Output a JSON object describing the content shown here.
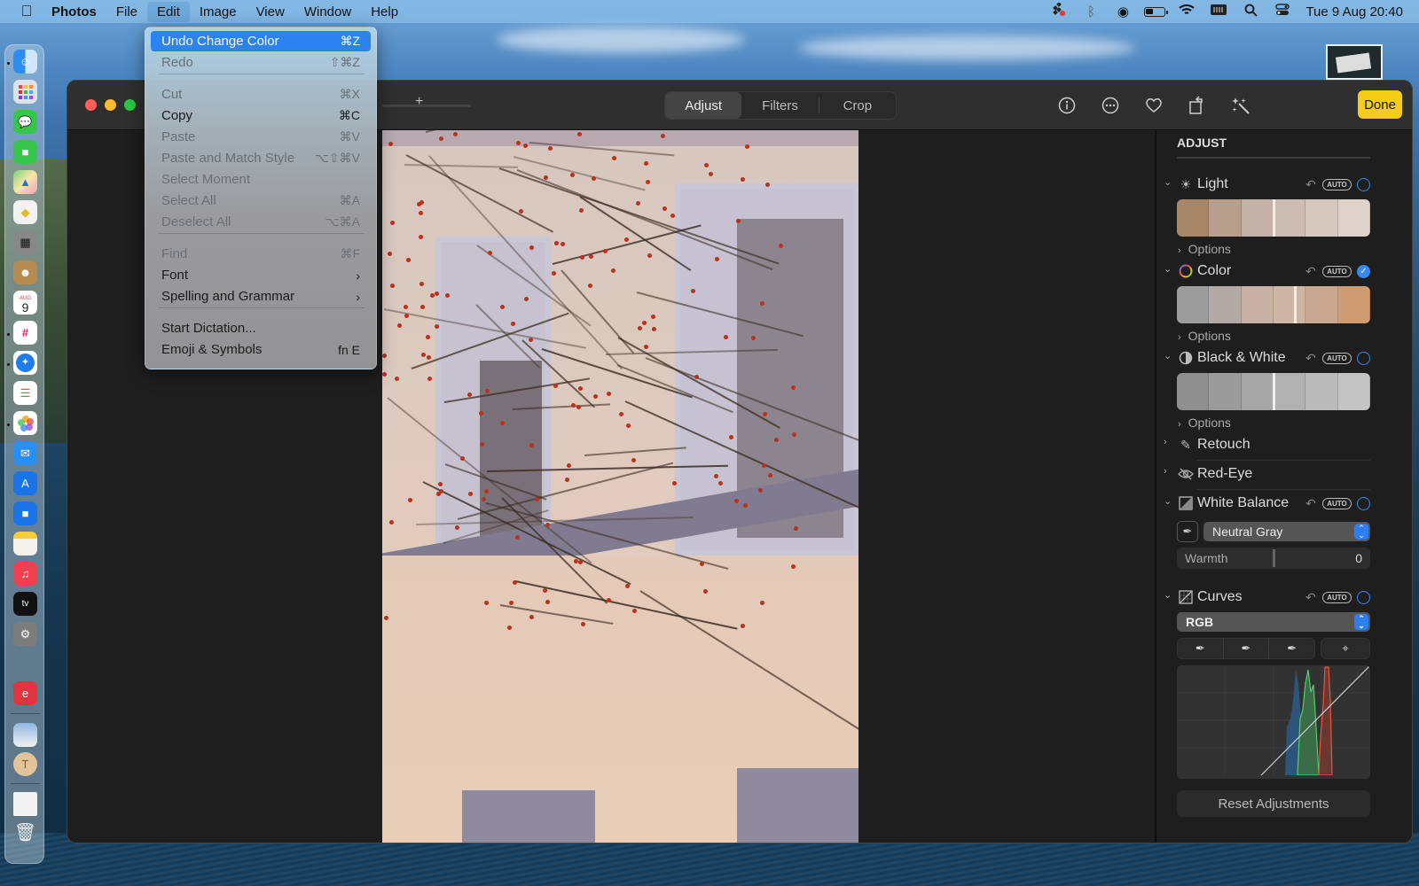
{
  "menubar": {
    "apple": "",
    "app_name": "Photos",
    "items": [
      "File",
      "Edit",
      "Image",
      "View",
      "Window",
      "Help"
    ],
    "active_menu": "Edit",
    "clock": "Tue 9 Aug  20:40"
  },
  "edit_menu": {
    "items": [
      {
        "label": "Undo Change Color",
        "shortcut": "⌘Z",
        "state": "highlighted"
      },
      {
        "label": "Redo",
        "shortcut": "⇧⌘Z",
        "state": "disabled"
      },
      {
        "label": "Cut",
        "shortcut": "⌘X",
        "state": "disabled"
      },
      {
        "label": "Copy",
        "shortcut": "⌘C",
        "state": "enabled"
      },
      {
        "label": "Paste",
        "shortcut": "⌘V",
        "state": "disabled"
      },
      {
        "label": "Paste and Match Style",
        "shortcut": "⌥⇧⌘V",
        "state": "disabled"
      },
      {
        "label": "Select Moment",
        "shortcut": "",
        "state": "disabled"
      },
      {
        "label": "Select All",
        "shortcut": "⌘A",
        "state": "disabled"
      },
      {
        "label": "Deselect All",
        "shortcut": "⌥⌘A",
        "state": "disabled"
      },
      {
        "label": "Find",
        "shortcut": "⌘F",
        "state": "disabled"
      },
      {
        "label": "Font",
        "shortcut": "›",
        "state": "enabled"
      },
      {
        "label": "Spelling and Grammar",
        "shortcut": "›",
        "state": "enabled"
      },
      {
        "label": "Start Dictation...",
        "shortcut": "",
        "state": "enabled"
      },
      {
        "label": "Emoji & Symbols",
        "shortcut": "fn E",
        "state": "enabled"
      }
    ]
  },
  "toolbar": {
    "zoom_plus": "+",
    "tabs": [
      {
        "label": "Adjust",
        "active": true
      },
      {
        "label": "Filters",
        "active": false
      },
      {
        "label": "Crop",
        "active": false
      }
    ],
    "done_label": "Done",
    "icons": [
      "info-icon",
      "more-icon",
      "heart-icon",
      "rotate-icon",
      "magic-wand-icon"
    ]
  },
  "adjust": {
    "header": "ADJUST",
    "sections": {
      "light": {
        "label": "Light",
        "auto": "AUTO",
        "enabled": false,
        "options": "Options"
      },
      "color": {
        "label": "Color",
        "auto": "AUTO",
        "enabled": true,
        "options": "Options"
      },
      "bw": {
        "label": "Black & White",
        "auto": "AUTO",
        "enabled": false,
        "options": "Options"
      },
      "retouch": {
        "label": "Retouch"
      },
      "redeye": {
        "label": "Red-Eye"
      },
      "white_balance": {
        "label": "White Balance",
        "auto": "AUTO",
        "enabled": false,
        "mode": "Neutral Gray",
        "warmth_label": "Warmth",
        "warmth_value": "0"
      },
      "curves": {
        "label": "Curves",
        "auto": "AUTO",
        "enabled": false,
        "channel": "RGB"
      }
    },
    "reset_label": "Reset Adjustments"
  },
  "colors": {
    "accent": "#2b82f0",
    "done": "#f5cc17",
    "radio": "#3b87f0"
  }
}
